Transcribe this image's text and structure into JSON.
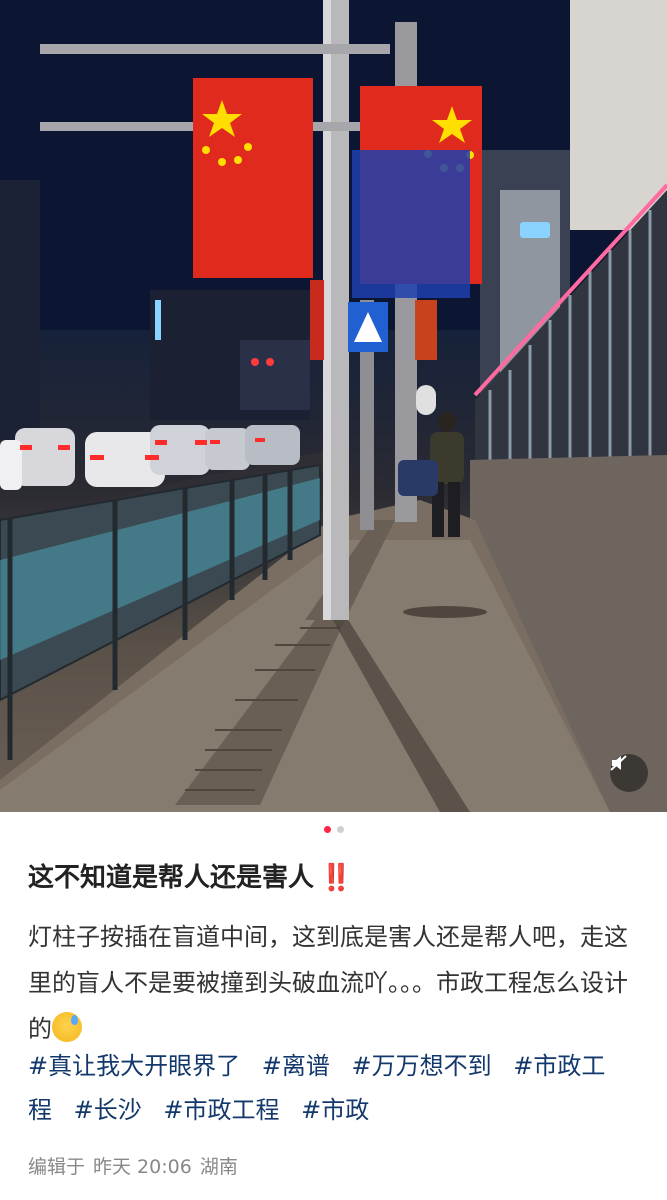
{
  "post": {
    "title": "这不知道是帮人还是害人",
    "title_emoji": "‼️",
    "body_text": "灯柱子按插在盲道中间，这到底是害人还是帮人吧，走这里的盲人不是要被撞到头破血流吖。。。市政工程怎么设计的",
    "body_emoji": "sweat-face-emoji",
    "tags": [
      "#真让我大开眼界了",
      "#离谱",
      "#万万想不到",
      "#市政工程",
      "#长沙",
      "#市政工程",
      "#市政"
    ]
  },
  "carousel": {
    "current_page": 1,
    "total_pages": 2
  },
  "footer": {
    "edited_label": "编辑于",
    "date": "昨天 20:06",
    "location": "湖南"
  },
  "photo": {
    "description_icon": "street-photo",
    "mute_icon": "speaker-muted-icon"
  },
  "colors": {
    "accent": "#ff2442",
    "tag": "#13386c",
    "meta": "#888888"
  }
}
